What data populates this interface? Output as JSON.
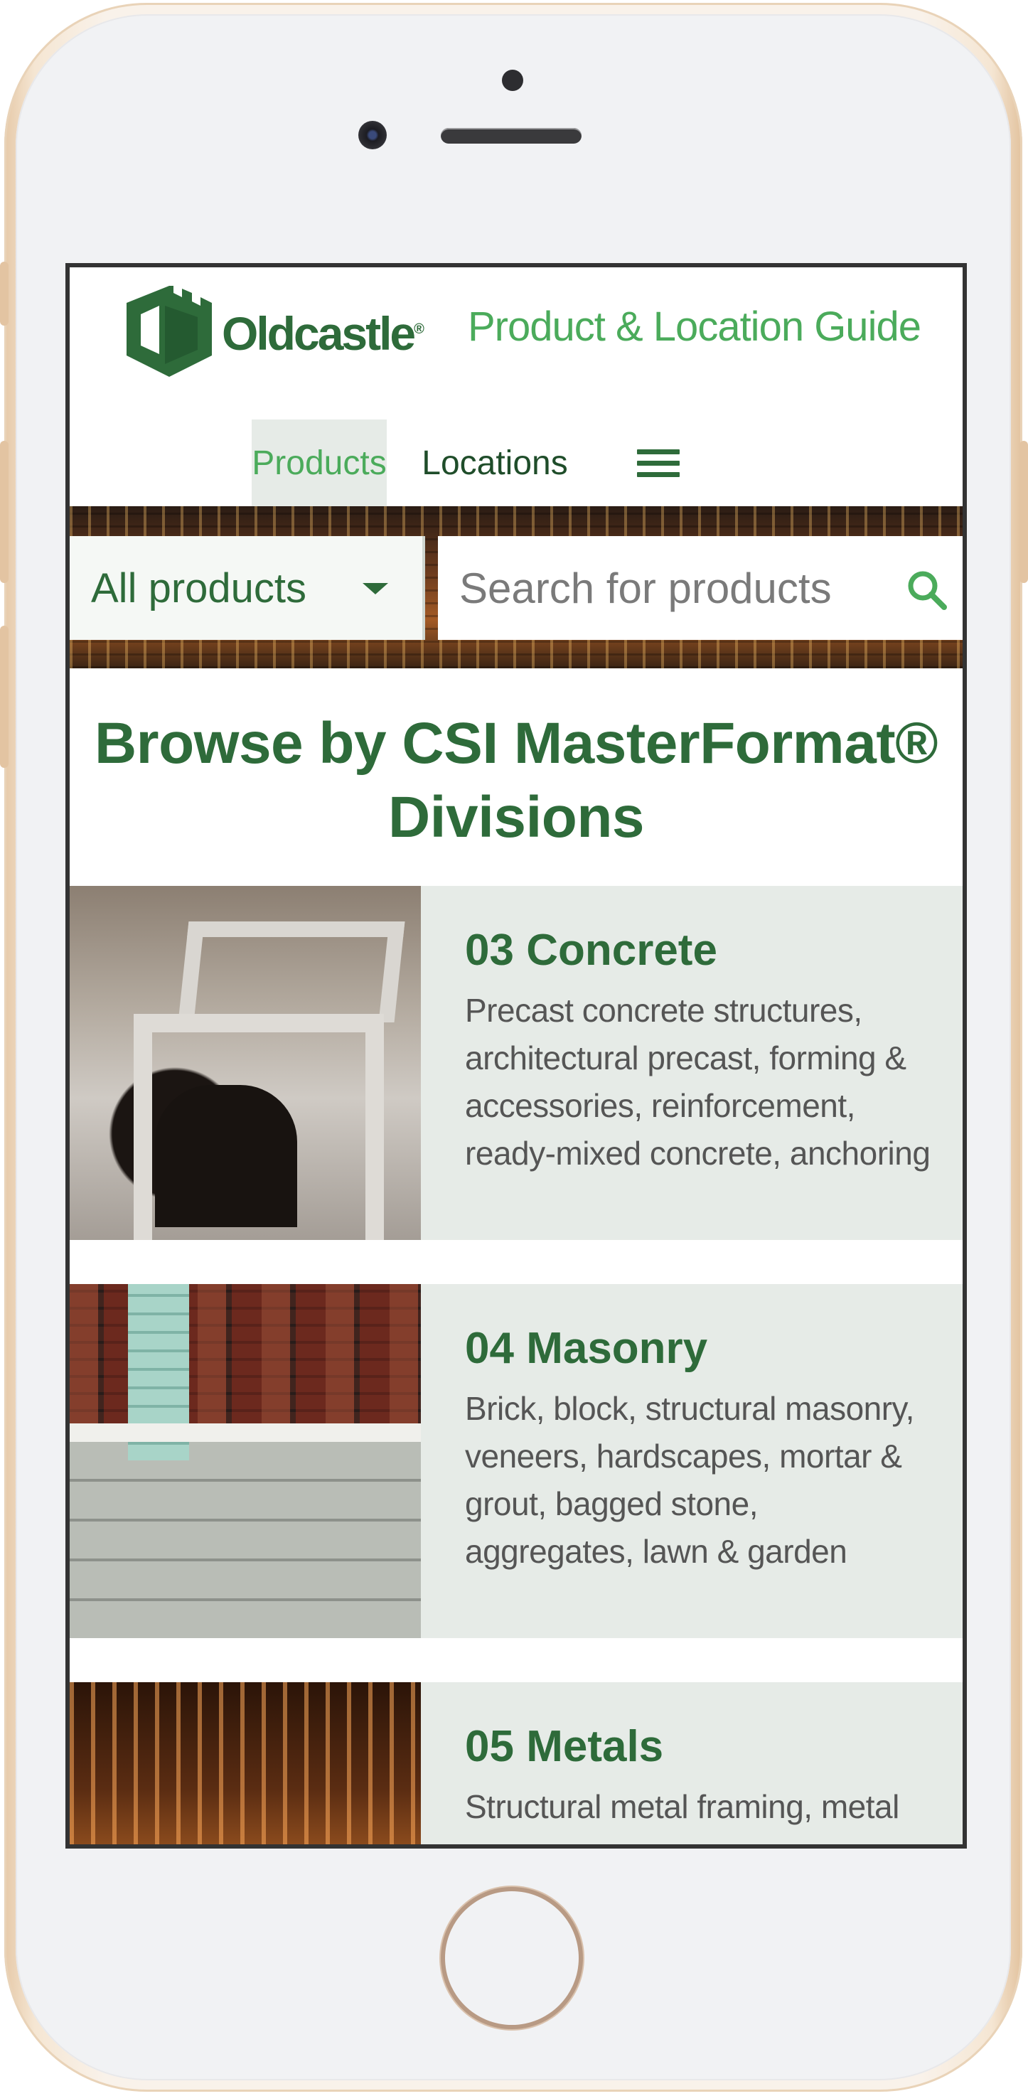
{
  "header": {
    "brand": "Oldcastle",
    "brand_mark": "®",
    "guide_title": "Product & Location Guide",
    "brand_color": "#2e6b3a",
    "accent_color": "#4bab5b"
  },
  "nav": {
    "tabs": [
      {
        "label": "Products",
        "active": true
      },
      {
        "label": "Locations",
        "active": false
      }
    ],
    "menu_icon": "hamburger-menu-icon"
  },
  "search": {
    "category_selected": "All products",
    "placeholder": "Search for products",
    "icon": "search-icon"
  },
  "browse": {
    "title": "Browse by CSI MasterFormat® Divisions",
    "divisions": [
      {
        "title": "03 Concrete",
        "description": "Precast concrete structures, architectural precast, forming & accessories, reinforcement, ready-mixed concrete, anchoring & fasteners, bagged"
      },
      {
        "title": "04 Masonry",
        "description": "Brick, block, structural masonry, veneers, hardscapes, mortar & grout, bagged stone, aggregates, lawn & garden products"
      },
      {
        "title": "05 Metals",
        "description": "Structural metal framing, metal"
      }
    ]
  }
}
